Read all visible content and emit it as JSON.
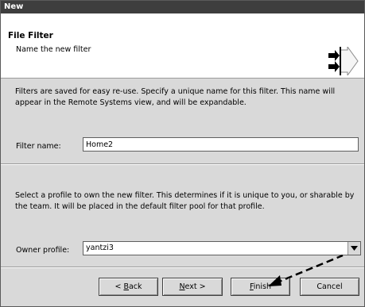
{
  "window": {
    "title": "New"
  },
  "banner": {
    "title": "File Filter",
    "description": "Name the new filter",
    "icon": "wizard-arrows-icon"
  },
  "filter_section": {
    "description": "Filters are saved for easy re-use. Specify a unique name for this filter. This name will appear in the Remote Systems view, and will be expandable.",
    "name_label": "Filter name:",
    "name_value": "Home2"
  },
  "profile_section": {
    "description": "Select a profile to own the new filter. This determines if it is unique to you, or sharable by the team. It will be placed in the default filter pool for that profile.",
    "owner_label": "Owner profile:",
    "owner_value": "yantzi3"
  },
  "buttons": {
    "back": {
      "prefix": "< ",
      "mnemonic": "B",
      "rest": "ack"
    },
    "next": {
      "mnemonic": "N",
      "rest": "ext >"
    },
    "finish": {
      "mnemonic": "F",
      "rest": "inish"
    },
    "cancel": {
      "label": "Cancel"
    }
  },
  "colors": {
    "titlebar": "#3e3e3e",
    "dialog_bg": "#d9d9d9",
    "banner_bg": "#ffffff"
  }
}
